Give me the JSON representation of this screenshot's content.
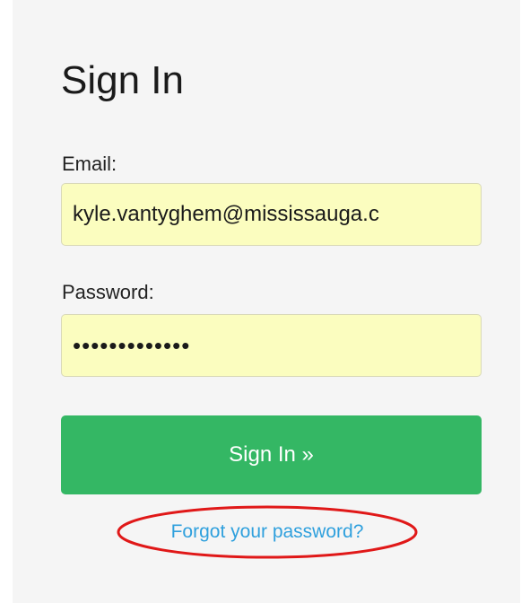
{
  "form": {
    "title": "Sign In",
    "email_label": "Email:",
    "email_value": "kyle.vantyghem@mississauga.c",
    "password_label": "Password:",
    "password_value": "•••••••••••••",
    "submit_label": "Sign In »",
    "forgot_label": "Forgot your password?"
  },
  "colors": {
    "page_background": "#ffffff",
    "card_background": "#f5f5f5",
    "input_background": "#fbfdbf",
    "button_green": "#34b764",
    "link_blue": "#2fa0dd",
    "annotation_red": "#e01818"
  },
  "annotation": {
    "shape": "ellipse",
    "target": "forgot-password-link"
  }
}
